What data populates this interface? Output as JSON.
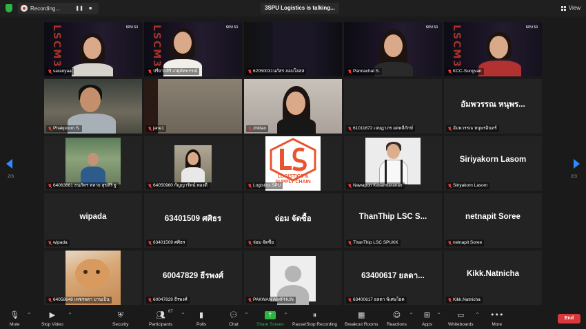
{
  "topbar": {
    "recording_label": "Recording...",
    "talking_label": "3SPU Logistics is talking...",
    "view_label": "View"
  },
  "pager": {
    "left": "2/3",
    "right": "2/3"
  },
  "tiles": [
    {
      "name": "saranyaa",
      "big": ""
    },
    {
      "name": "ปรียากสิริ เกตุคัทบรรณ์",
      "big": ""
    },
    {
      "name": "62050031นภัสร ลอมโฮสส",
      "big": ""
    },
    {
      "name": "Pannachat S.",
      "big": ""
    },
    {
      "name": "KCC-Sungvan",
      "big": ""
    },
    {
      "name": "Phakpoom S.",
      "big": ""
    },
    {
      "name": "jane1",
      "big": ""
    },
    {
      "name": "zhldao",
      "big": ""
    },
    {
      "name": "61011672 เจษฎาภร อดพลีภักษ์",
      "big": ""
    },
    {
      "name": "อัมพวรรณ หนุพรอินทร์",
      "big": "อัมพวรรณ หนุพร..."
    },
    {
      "name": "64063661 ธนภัทร ทลาย สุขสิริ ฐ",
      "big": ""
    },
    {
      "name": "64050960 กัญญารัตน์ ทองดี",
      "big": ""
    },
    {
      "name": "Logistics SPU",
      "big": ""
    },
    {
      "name": "Nawapon Kasamtaranan",
      "big": ""
    },
    {
      "name": "Siriyakorn Lasom",
      "big": "Siriyakorn Lasom"
    },
    {
      "name": "wipada",
      "big": "wipada"
    },
    {
      "name": "63401509 ศศิธร",
      "big": "63401509 ศศิธร"
    },
    {
      "name": "จ่อม จัดซื้อ",
      "big": "จ่อม จัดซื้อ"
    },
    {
      "name": "ThanThip LSC SPUKK",
      "big": "ThanThip LSC S..."
    },
    {
      "name": "netnapit Soree",
      "big": "netnapit Soree"
    },
    {
      "name": "64058648 เพชรลดา บานเป็น",
      "big": ""
    },
    {
      "name": "60047829 ธีรพงศ์",
      "big": "60047829 ธีรพงศ์"
    },
    {
      "name": "PAKWAN AIMPHUN",
      "big": ""
    },
    {
      "name": "63400617 ยลดา พิเศษโยค",
      "big": "63400617 ยลดา..."
    },
    {
      "name": "Kikk.Natnicha",
      "big": "Kikk.Natnicha"
    }
  ],
  "logo_tile": {
    "line1": "LOGISTICS &",
    "line2": "SUPPLY CHAIN"
  },
  "scm_text": "LSCM3",
  "spu_text": "SPU 53",
  "toolbar": {
    "mute": "Mute",
    "stop_video": "Stop Video",
    "security": "Security",
    "participants": "Participants",
    "participants_count": "67",
    "polls": "Polls",
    "chat": "Chat",
    "share_screen": "Share Screen",
    "recording": "Pause/Stop Recording",
    "breakout": "Breakout Rooms",
    "reactions": "Reactions",
    "apps": "Apps",
    "whiteboards": "Whiteboards",
    "more": "More",
    "end": "End"
  },
  "colors": {
    "accent": "#2d8cff",
    "share": "#2fb344",
    "end": "#d9383c"
  }
}
